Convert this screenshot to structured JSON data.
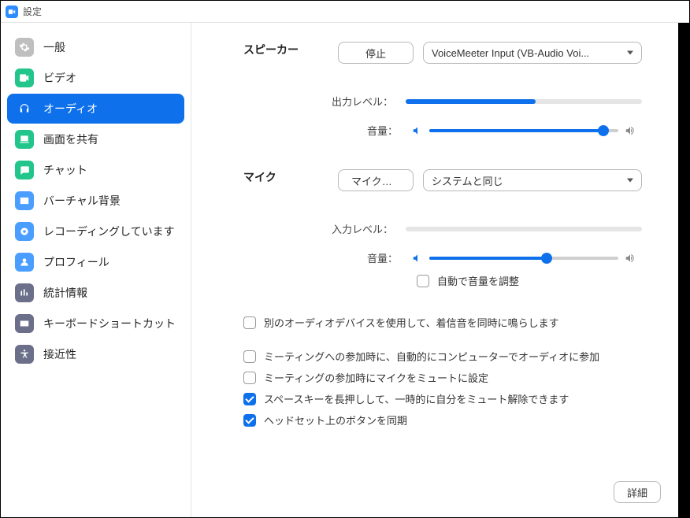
{
  "window": {
    "title": "設定"
  },
  "sidebar": {
    "items": [
      {
        "label": "一般",
        "icon": "gear-icon",
        "color": "#bfbfbf"
      },
      {
        "label": "ビデオ",
        "icon": "video-icon",
        "color": "#22c58b"
      },
      {
        "label": "オーディオ",
        "icon": "headphones-icon",
        "color": "#0e71eb",
        "active": true
      },
      {
        "label": "画面を共有",
        "icon": "share-icon",
        "color": "#22c58b"
      },
      {
        "label": "チャット",
        "icon": "chat-icon",
        "color": "#22c58b"
      },
      {
        "label": "バーチャル背景",
        "icon": "background-icon",
        "color": "#4a9eff"
      },
      {
        "label": "レコーディングしています",
        "icon": "record-icon",
        "color": "#4a9eff"
      },
      {
        "label": "プロフィール",
        "icon": "profile-icon",
        "color": "#4a9eff"
      },
      {
        "label": "統計情報",
        "icon": "stats-icon",
        "color": "#6b6f8a"
      },
      {
        "label": "キーボードショートカット",
        "icon": "keyboard-icon",
        "color": "#6b6f8a"
      },
      {
        "label": "接近性",
        "icon": "accessibility-icon",
        "color": "#6b6f8a"
      }
    ]
  },
  "speaker": {
    "section_label": "スピーカー",
    "test_button": "停止",
    "device": "VoiceMeeter Input (VB-Audio Voi...",
    "output_level_label": "出力レベル：",
    "output_level_percent": 55,
    "volume_label": "音量：",
    "volume_percent": 92
  },
  "mic": {
    "section_label": "マイク",
    "test_button": "マイクのテ...",
    "device": "システムと同じ",
    "input_level_label": "入力レベル：",
    "input_level_percent": 0,
    "volume_label": "音量：",
    "volume_percent": 62,
    "auto_adjust_label": "自動で音量を調整"
  },
  "options": {
    "ring_other_device": "別のオーディオデバイスを使用して、着信音を同時に鳴らします",
    "auto_join_audio": "ミーティングへの参加時に、自動的にコンピューターでオーディオに参加",
    "mute_on_join": "ミーティングの参加時にマイクをミュートに設定",
    "push_to_talk": "スペースキーを長押しして、一時的に自分をミュート解除できます",
    "sync_headset": "ヘッドセット上のボタンを同期"
  },
  "buttons": {
    "advanced": "詳細"
  }
}
